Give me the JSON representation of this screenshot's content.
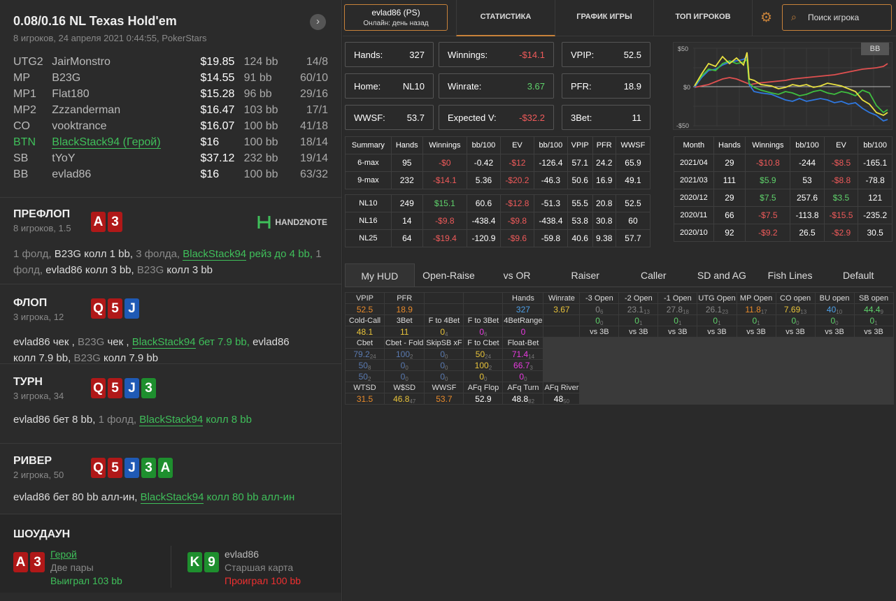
{
  "hand": {
    "title": "0.08/0.16 NL Texas Hold'em",
    "subtitle": "8 игроков, 24 апреля 2021 0:44:55, PokerStars",
    "players": [
      {
        "pos": "UTG2",
        "name": "JairMonstro",
        "stack": "$19.85",
        "bb": "124 bb",
        "ratio": "14/8"
      },
      {
        "pos": "MP",
        "name": "B23G",
        "stack": "$14.55",
        "bb": "91 bb",
        "ratio": "60/10"
      },
      {
        "pos": "MP1",
        "name": "Flat180",
        "stack": "$15.28",
        "bb": "96 bb",
        "ratio": "29/16"
      },
      {
        "pos": "MP2",
        "name": "Zzzanderman",
        "stack": "$16.47",
        "bb": "103 bb",
        "ratio": "17/1"
      },
      {
        "pos": "CO",
        "name": "vooktrance",
        "stack": "$16.07",
        "bb": "100 bb",
        "ratio": "41/18"
      },
      {
        "pos": "BTN",
        "name": "BlackStack94 (Герой)",
        "stack": "$16",
        "bb": "100 bb",
        "ratio": "18/14"
      },
      {
        "pos": "SB",
        "name": "tYoY",
        "stack": "$37.12",
        "bb": "232 bb",
        "ratio": "19/14"
      },
      {
        "pos": "BB",
        "name": "evlad86",
        "stack": "$16",
        "bb": "100 bb",
        "ratio": "63/32"
      }
    ]
  },
  "streets": {
    "preflop": {
      "title": "ПРЕФЛОП",
      "sub": "8 игроков, 1.5",
      "logo": "HAND2NOTE",
      "a1": "1 фолд, ",
      "a2": "B23G",
      "a3": " колл 1 bb, ",
      "a4": "3 фолда, ",
      "a5": "BlackStack94",
      "a6": " рейз до 4 bb, ",
      "a7": "1 фолд, ",
      "a8": "evlad86",
      "a9": " колл 3 bb, ",
      "a10": "B23G",
      "a11": " колл 3 bb"
    },
    "flop": {
      "title": "ФЛОП",
      "sub": "3 игрока, 12",
      "a1": "evlad86",
      "a2": " чек , ",
      "a3": "B23G",
      "a4": " чек , ",
      "a5": "BlackStack94",
      "a6": " бет 7.9 bb, ",
      "a7": "evlad86",
      "a8": " колл 7.9 bb, ",
      "a9": "B23G",
      "a10": " колл 7.9 bb"
    },
    "turn": {
      "title": "ТУРН",
      "sub": "3 игрока, 34",
      "a1": "evlad86",
      "a2": " бет 8 bb, ",
      "a3": "1 фолд, ",
      "a4": "BlackStack94",
      "a5": " колл 8 bb"
    },
    "river": {
      "title": "РИВЕР",
      "sub": "2 игрока, 50",
      "a1": "evlad86",
      "a2": " бет 80 bb алл-ин, ",
      "a3": "BlackStack94",
      "a4": " колл 80 bb алл-ин"
    },
    "showdown": {
      "title": "ШОУДАУН",
      "p1_name": "Герой",
      "p1_hand": "Две пары",
      "p1_result": "Выиграл 103 bb",
      "p2_name": "evlad86",
      "p2_hand": "Старшая карта",
      "p2_result": "Проиграл 100 bb"
    }
  },
  "cards": {
    "hero": [
      "A",
      "3"
    ],
    "flop": [
      "Q",
      "5",
      "J"
    ],
    "turn": "3",
    "river": "A",
    "villain": [
      "K",
      "9"
    ]
  },
  "top": {
    "player": "evlad86 (PS)",
    "online": "Онлайн: день назад",
    "tabs": [
      "СТАТИСТИКА",
      "ГРАФИК ИГРЫ",
      "ТОП ИГРОКОВ"
    ],
    "search": "Поиск игрока",
    "chart_badge": "BB",
    "y_labels": [
      "$50",
      "$0",
      "-$50"
    ]
  },
  "stats": [
    {
      "k": "Hands:",
      "v": "327",
      "c": "w"
    },
    {
      "k": "Winnings:",
      "v": "-$14.1",
      "c": "red"
    },
    {
      "k": "VPIP:",
      "v": "52.5",
      "c": "w"
    },
    {
      "k": "Home:",
      "v": "NL10",
      "c": "w"
    },
    {
      "k": "Winrate:",
      "v": "3.67",
      "c": "grn"
    },
    {
      "k": "PFR:",
      "v": "18.9",
      "c": "w"
    },
    {
      "k": "WWSF:",
      "v": "53.7",
      "c": "w"
    },
    {
      "k": "Expected V:",
      "v": "-$32.2",
      "c": "red"
    },
    {
      "k": "3Bet:",
      "v": "11",
      "c": "w"
    }
  ],
  "summary": {
    "headers": [
      "Summary",
      "Hands",
      "Winnings",
      "bb/100",
      "EV",
      "bb/100",
      "VPIP",
      "PFR",
      "WWSF"
    ],
    "rows": [
      [
        "6-max",
        "95",
        "-$0",
        "-0.42",
        "-$12",
        "-126.4",
        "57.1",
        "24.2",
        "65.9"
      ],
      [
        "9-max",
        "232",
        "-$14.1",
        "5.36",
        "-$20.2",
        "-46.3",
        "50.6",
        "16.9",
        "49.1"
      ],
      [
        "NL10",
        "249",
        "$15.1",
        "60.6",
        "-$12.8",
        "-51.3",
        "55.5",
        "20.8",
        "52.5"
      ],
      [
        "NL16",
        "14",
        "-$9.8",
        "-438.4",
        "-$9.8",
        "-438.4",
        "53.8",
        "30.8",
        "60"
      ],
      [
        "NL25",
        "64",
        "-$19.4",
        "-120.9",
        "-$9.6",
        "-59.8",
        "40.6",
        "9.38",
        "57.7"
      ]
    ]
  },
  "month": {
    "headers": [
      "Month",
      "Hands",
      "Winnings",
      "bb/100",
      "EV",
      "bb/100"
    ],
    "rows": [
      [
        "2021/04",
        "29",
        "-$10.8",
        "-244",
        "-$8.5",
        "-165.1"
      ],
      [
        "2021/03",
        "111",
        "$5.9",
        "53",
        "-$8.8",
        "-78.8"
      ],
      [
        "2020/12",
        "29",
        "$7.5",
        "257.6",
        "$3.5",
        "121"
      ],
      [
        "2020/11",
        "66",
        "-$7.5",
        "-113.8",
        "-$15.5",
        "-235.2"
      ],
      [
        "2020/10",
        "92",
        "-$9.2",
        "26.5",
        "-$2.9",
        "30.5"
      ]
    ]
  },
  "hudtabs": [
    "My HUD",
    "Open-Raise",
    "vs OR",
    "Raiser",
    "Caller",
    "SD and AG",
    "Fish Lines",
    "Default"
  ],
  "hud": {
    "r1": [
      "VPIP",
      "PFR",
      "",
      "",
      "Hands",
      "Winrate",
      "-3 Open",
      "-2 Open",
      "-1 Open",
      "UTG Open",
      "MP Open",
      "CO open",
      "BU open",
      "SB open"
    ],
    "r2": [
      "52.5",
      "18.9",
      "",
      "",
      "327",
      "3.67",
      "0",
      "23.1",
      "27.8",
      "26.1",
      "11.8",
      "7.69",
      "40",
      "44.4"
    ],
    "r2s": [
      "",
      "",
      "",
      "",
      "",
      "",
      "6",
      "13",
      "18",
      "23",
      "17",
      "13",
      "10",
      "9"
    ],
    "r3": [
      "Cold-Call",
      "3Bet",
      "F to 4Bet",
      "F to 3Bet",
      "4BetRange"
    ],
    "r3b": [
      "0",
      "0",
      "0",
      "0",
      "0",
      "0",
      "0",
      "0"
    ],
    "r3bs": [
      "0",
      "1",
      "1",
      "1",
      "1",
      "0",
      "0",
      "1"
    ],
    "r4": [
      "48.1",
      "11",
      "0",
      "0",
      "0"
    ],
    "r4s": [
      "",
      "",
      "4",
      "6",
      ""
    ],
    "vs3b": "vs 3B",
    "r5": [
      "Cbet",
      "Cbet - Fold",
      "SkipSB xF",
      "F to Cbet",
      "Float-Bet"
    ],
    "r6": [
      "79.2",
      "100",
      "0",
      "50",
      "71.4"
    ],
    "r6s": [
      "24",
      "2",
      "0",
      "24",
      "14"
    ],
    "r7": [
      "50",
      "0",
      "0",
      "100",
      "66.7"
    ],
    "r7s": [
      "8",
      "0",
      "0",
      "2",
      "3"
    ],
    "r8": [
      "50",
      "0",
      "0",
      "0",
      "0"
    ],
    "r8s": [
      "2",
      "0",
      "0",
      "0",
      "0"
    ],
    "r9": [
      "WTSD",
      "W$SD",
      "WWSF",
      "AFq Flop",
      "AFq Turn",
      "AFq River"
    ],
    "r10": [
      "31.5",
      "46.8",
      "53.7",
      "52.9",
      "48.8",
      "48"
    ],
    "r10s": [
      "",
      "47",
      "",
      "",
      "82",
      "50"
    ]
  }
}
